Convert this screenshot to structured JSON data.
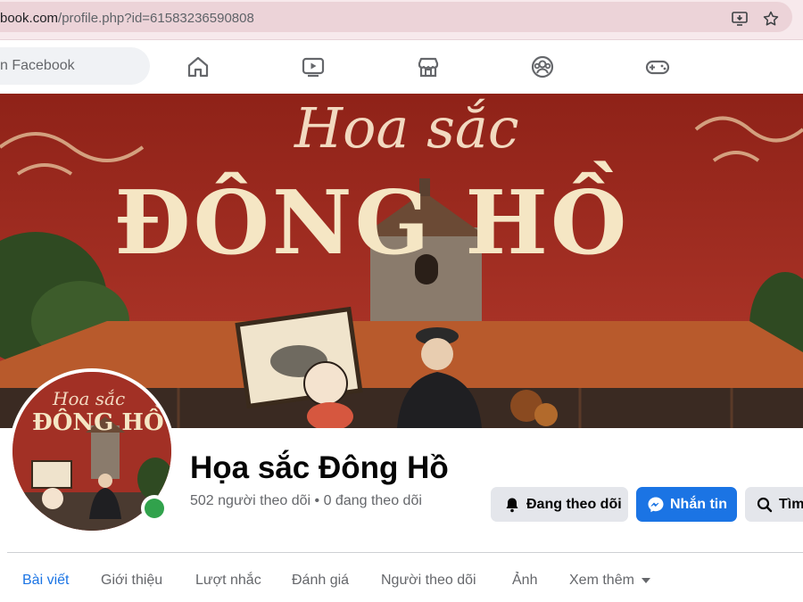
{
  "browser": {
    "url_domain": "book.com",
    "url_path": "/profile.php?id=61583236590808",
    "icons": [
      "install-app-icon",
      "bookmark-star-icon"
    ]
  },
  "fb_nav": {
    "search_placeholder": "n Facebook",
    "icons": [
      "home-icon",
      "video-icon",
      "marketplace-icon",
      "groups-icon",
      "gaming-icon"
    ]
  },
  "cover": {
    "script_title": "Hoa sắc",
    "main_title": "ĐÔNG HỒ"
  },
  "avatar": {
    "script_title": "Hoa sắc",
    "main_title": "ĐÔNG HỒ"
  },
  "profile": {
    "name": "Họa sắc Đông Hồ",
    "followers_text": "502 người theo dõi • 0 đang theo dõi"
  },
  "actions": {
    "following_label": "Đang theo dõi",
    "message_label": "Nhắn tin",
    "search_label": "Tìm"
  },
  "tabs": [
    {
      "label": "Bài viết",
      "active": true
    },
    {
      "label": "Giới thiệu"
    },
    {
      "label": "Lượt nhắc"
    },
    {
      "label": "Đánh giá"
    },
    {
      "label": "Người theo dõi"
    },
    {
      "label": "Ảnh"
    },
    {
      "label": "Xem thêm"
    }
  ],
  "colors": {
    "accent": "#1b74e4",
    "cover_red": "#9a2a22",
    "online": "#31a24c"
  }
}
